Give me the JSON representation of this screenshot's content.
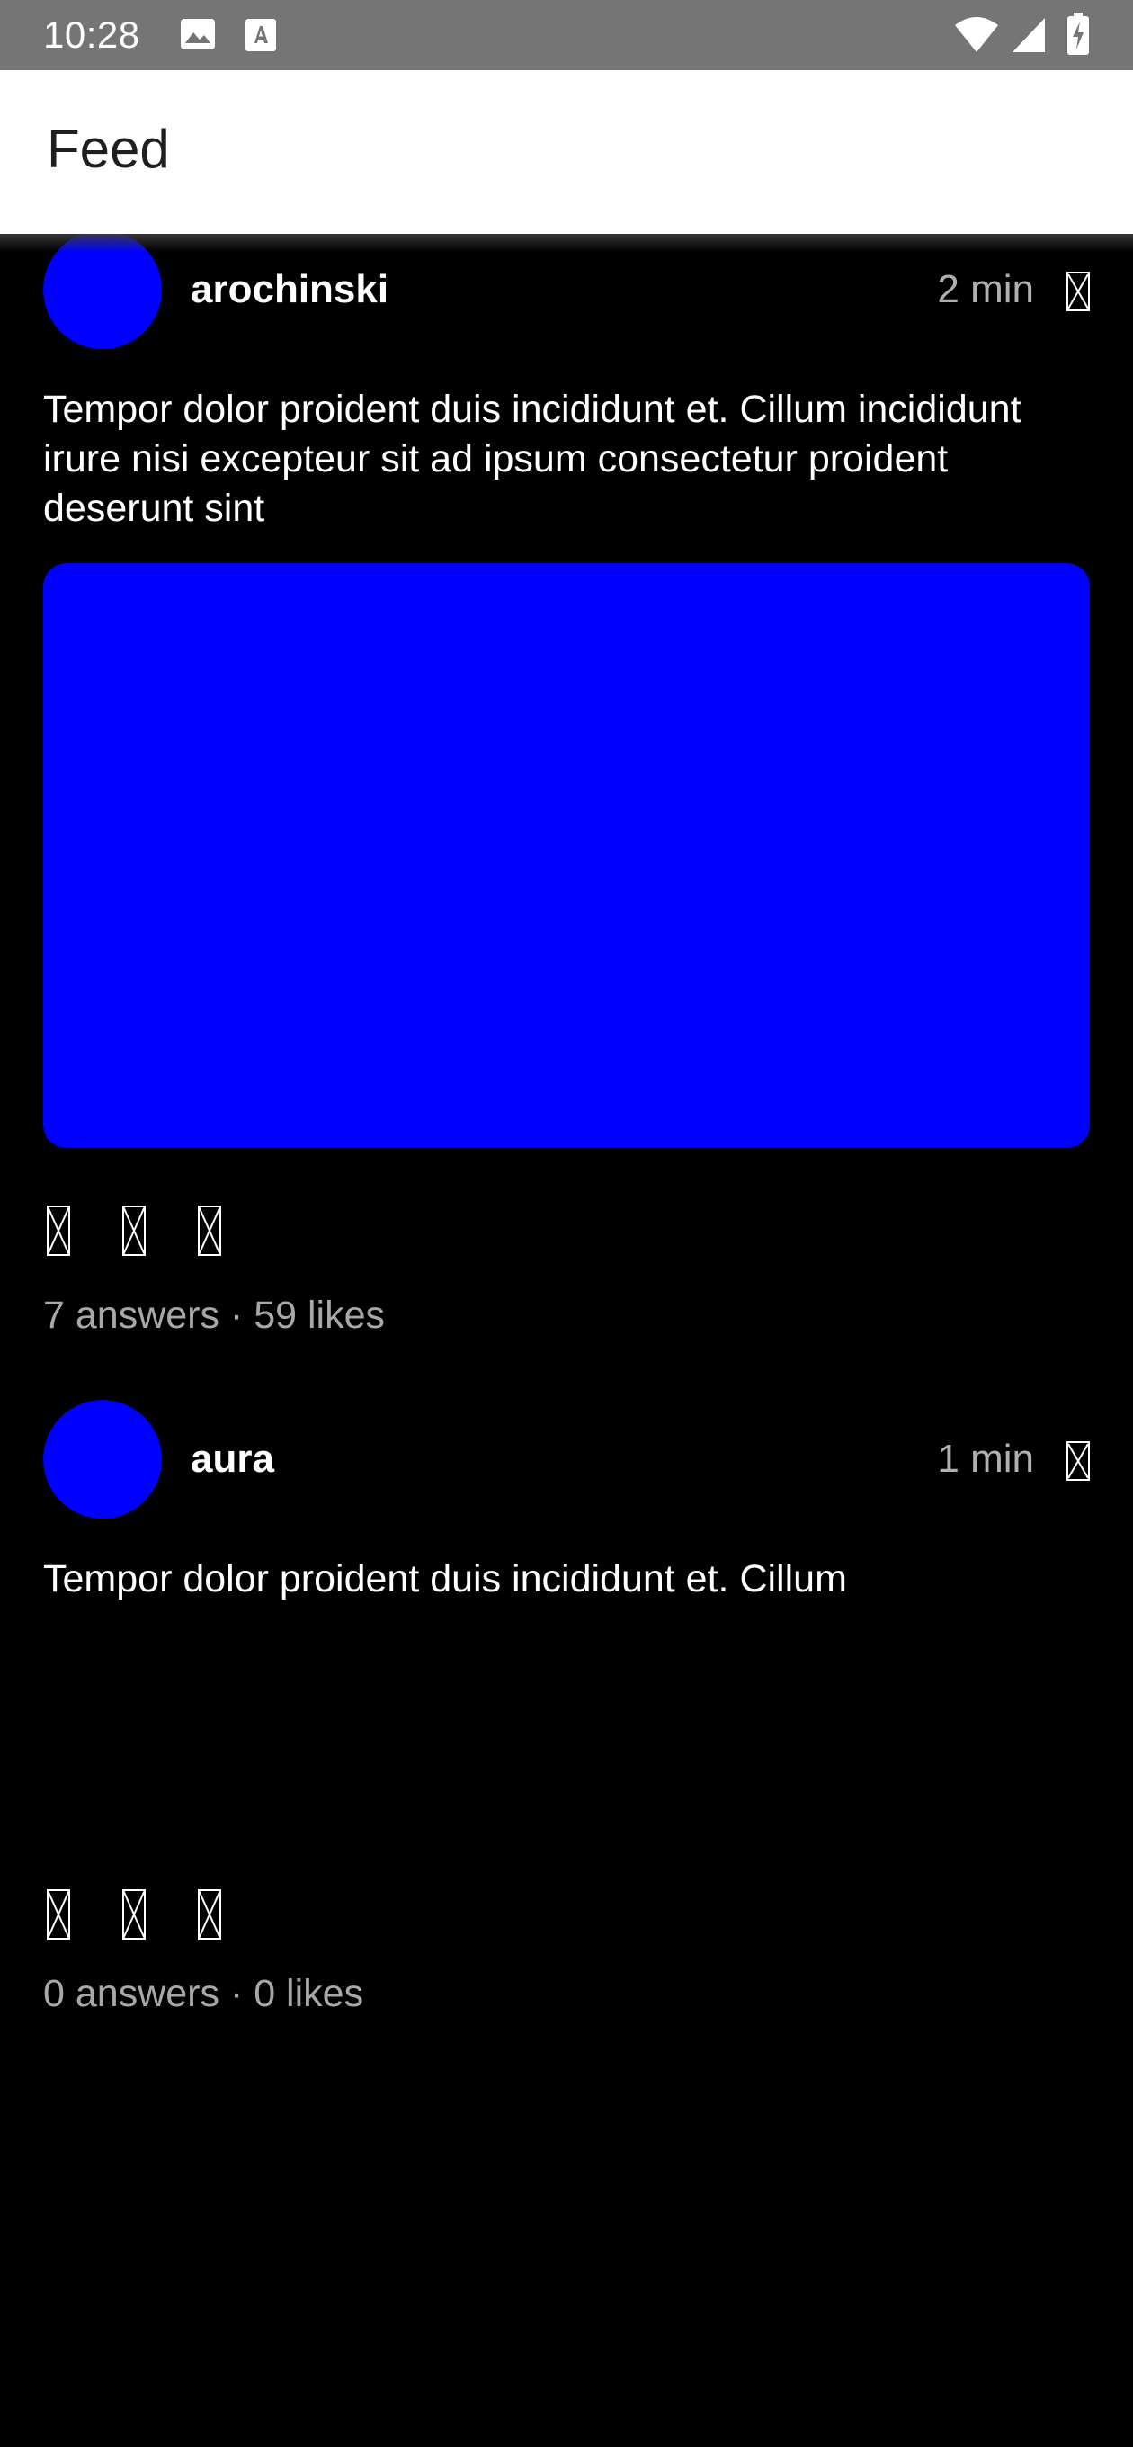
{
  "status_bar": {
    "time": "10:28",
    "icons": [
      "gallery-icon",
      "font-download-icon",
      "wifi-icon",
      "signal-icon",
      "battery-charging-icon"
    ]
  },
  "app_bar": {
    "title": "Feed"
  },
  "colors": {
    "status_bar_bg": "#757575",
    "app_bar_bg": "#ffffff",
    "feed_bg": "#000000",
    "avatar": "#0000ff",
    "image_placeholder": "#0000ff",
    "secondary_text": "#b0b0b0"
  },
  "posts": [
    {
      "username": "arochinski",
      "time": "2 min",
      "text": "Tempor dolor proident duis incididunt et. Cillum incididunt irure nisi excepteur sit ad ipsum consectetur proident deserunt sint",
      "has_image": true,
      "stats": "7 answers · 59 likes",
      "icons": [
        "more-options-icon",
        "action-icon-1",
        "action-icon-2",
        "action-icon-3"
      ]
    },
    {
      "username": "aura",
      "time": "1 min",
      "text": "Tempor dolor proident duis incididunt et. Cillum",
      "has_image": false,
      "stats": "0 answers · 0 likes",
      "icons": [
        "more-options-icon",
        "action-icon-1",
        "action-icon-2",
        "action-icon-3"
      ]
    }
  ]
}
